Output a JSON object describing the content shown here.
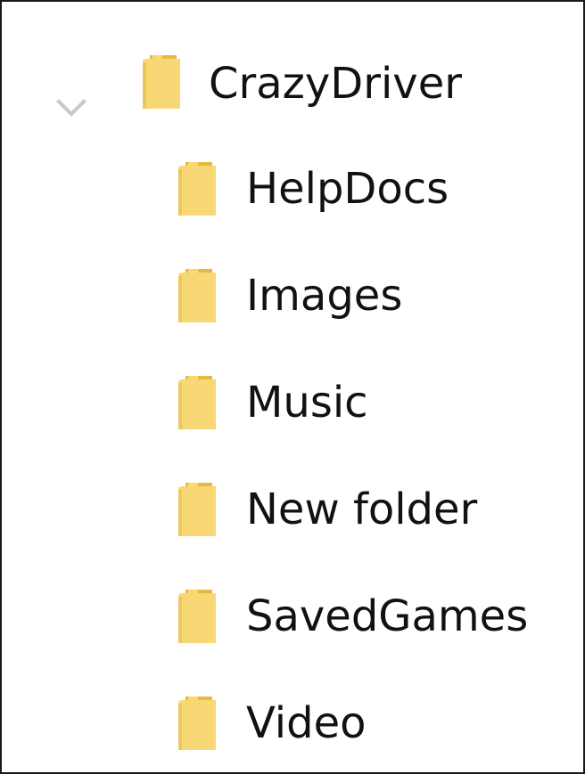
{
  "colors": {
    "folder_front": "#F8D775",
    "folder_back": "#E8B93F",
    "chevron": "#C8C8C8",
    "text": "#111111",
    "border": "#1A1A1A"
  },
  "tree": {
    "root": {
      "label": "CrazyDriver",
      "icon": "folder-icon",
      "expand_icon": "chevron-down-icon",
      "expanded": true
    },
    "children": [
      {
        "label": "HelpDocs",
        "icon": "folder-icon"
      },
      {
        "label": "Images",
        "icon": "folder-icon"
      },
      {
        "label": "Music",
        "icon": "folder-icon"
      },
      {
        "label": "New folder",
        "icon": "folder-icon"
      },
      {
        "label": "SavedGames",
        "icon": "folder-icon"
      },
      {
        "label": "Video",
        "icon": "folder-icon"
      }
    ]
  }
}
